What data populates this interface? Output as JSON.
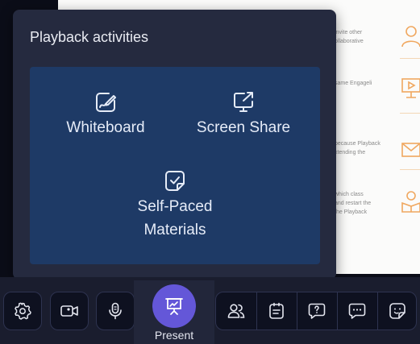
{
  "slide": {
    "rows": [
      {
        "text": "invite other\nollaborative"
      },
      {
        "text": "same Engageli"
      },
      {
        "text": "because Playback\nxtending the"
      },
      {
        "text": "which class\nand restart the\nthe Playback"
      }
    ]
  },
  "popup": {
    "title": "Playback activities",
    "activities": [
      {
        "label": "Whiteboard",
        "icon": "whiteboard-pencil-icon"
      },
      {
        "label": "Screen Share",
        "icon": "screen-share-icon"
      },
      {
        "label": "Self-Paced\nMaterials",
        "icon": "document-check-icon"
      }
    ]
  },
  "toolbar": {
    "left_buttons": [
      {
        "icon": "gear-icon"
      },
      {
        "icon": "video-camera-icon"
      },
      {
        "icon": "microphone-icon"
      }
    ],
    "present_label": "Present",
    "right_buttons": [
      {
        "icon": "participants-icon"
      },
      {
        "icon": "notes-icon"
      },
      {
        "icon": "question-icon"
      },
      {
        "icon": "chat-icon"
      },
      {
        "icon": "sticker-icon"
      }
    ]
  },
  "colors": {
    "popup_bg": "#252a3f",
    "grid_bg": "#1e3a66",
    "toolbar_bg": "#1a1d2e",
    "present_accent": "#6457d8",
    "slide_accent": "#f0a860"
  }
}
